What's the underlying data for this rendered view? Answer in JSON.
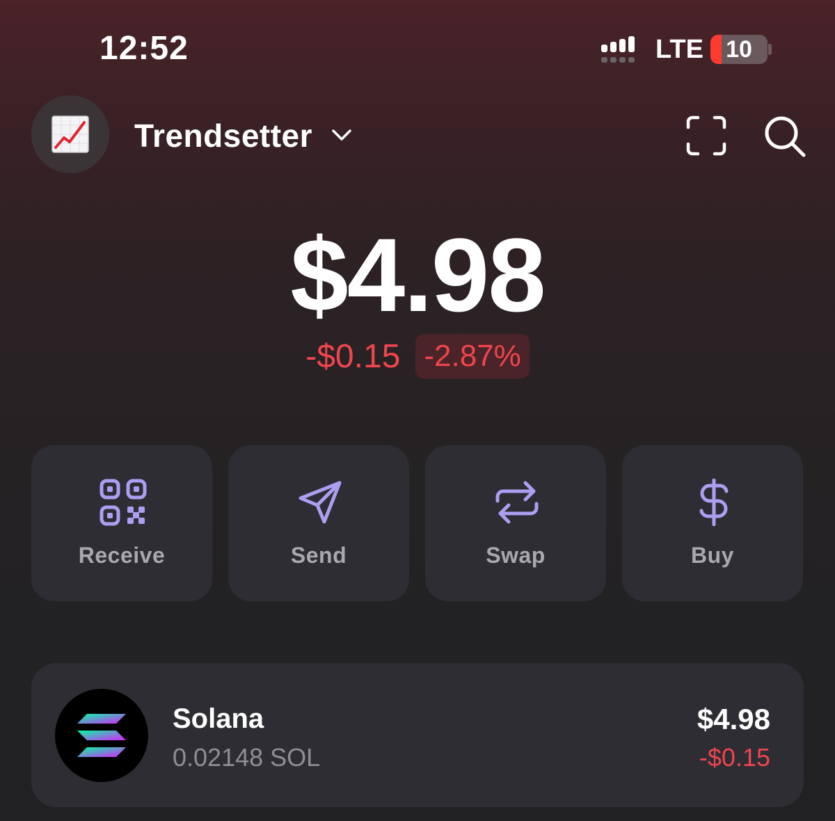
{
  "status_bar": {
    "time": "12:52",
    "network": "LTE",
    "battery_level": "10",
    "battery_fraction": 0.1,
    "signal_bars_active": 4
  },
  "header": {
    "account_name": "Trendsetter",
    "avatar_icon": "chart-increasing-emoji",
    "icons": [
      "chevron-down-icon",
      "scan-icon",
      "search-icon"
    ]
  },
  "portfolio": {
    "balance": "$4.98",
    "change_amount": "-$0.15",
    "change_percent": "-2.87%"
  },
  "actions": [
    {
      "label": "Receive",
      "icon": "qr-code-icon"
    },
    {
      "label": "Send",
      "icon": "send-icon"
    },
    {
      "label": "Swap",
      "icon": "swap-icon"
    },
    {
      "label": "Buy",
      "icon": "dollar-icon"
    }
  ],
  "tokens": [
    {
      "name": "Solana",
      "amount": "0.02148 SOL",
      "value": "$4.98",
      "change": "-$0.15",
      "icon": "solana-logo"
    }
  ],
  "colors": {
    "accent_purple": "#ab9ff2",
    "negative_red": "#f0454d",
    "card_background": "#2e2d33",
    "muted_text": "#8e8e94"
  }
}
